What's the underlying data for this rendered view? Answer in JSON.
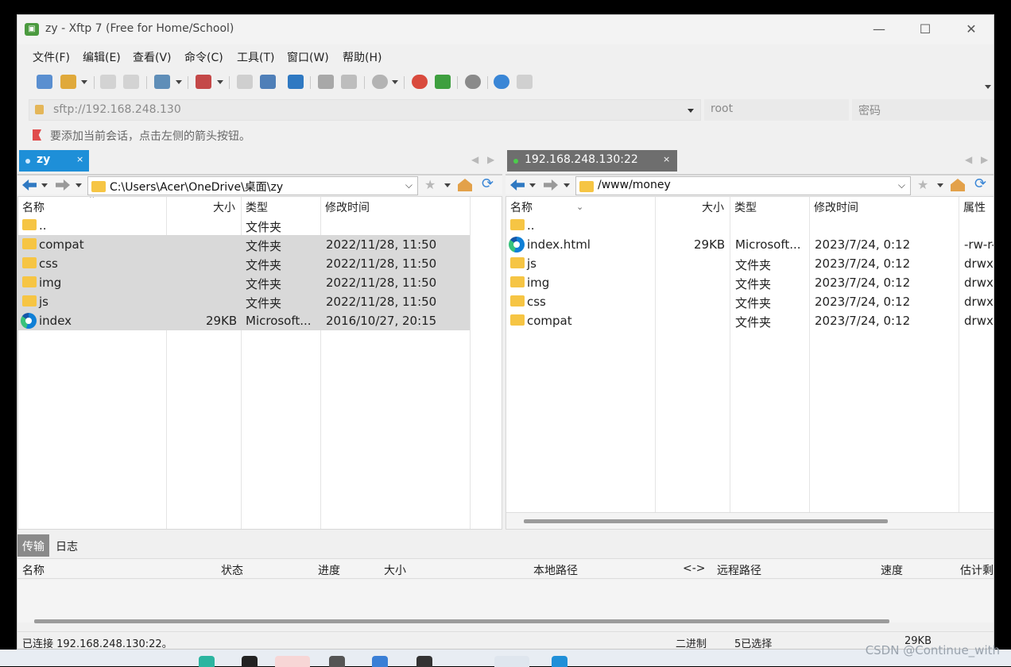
{
  "window": {
    "title": "zy - Xftp 7 (Free for Home/School)",
    "app_icon": "xftp-icon",
    "minimize": "—",
    "maximize": "☐",
    "close": "✕"
  },
  "menu": [
    "文件(F)",
    "编辑(E)",
    "查看(V)",
    "命令(C)",
    "工具(T)",
    "窗口(W)",
    "帮助(H)"
  ],
  "address": {
    "host": "sftp://192.168.248.130",
    "user_placeholder": "root",
    "password_placeholder": "密码"
  },
  "hint": "要添加当前会话，点击左侧的箭头按钮。",
  "left_pane": {
    "tab_label": "zy",
    "tab_close": "×",
    "path": "C:\\Users\\Acer\\OneDrive\\桌面\\zy",
    "columns": [
      "名称",
      "大小",
      "类型",
      "修改时间"
    ],
    "rows": [
      {
        "name": "..",
        "size": "",
        "type": "文件夹",
        "modified": "",
        "icon": "folder-icon",
        "selected": false
      },
      {
        "name": "compat",
        "size": "",
        "type": "文件夹",
        "modified": "2022/11/28, 11:50",
        "icon": "folder-icon",
        "selected": true
      },
      {
        "name": "css",
        "size": "",
        "type": "文件夹",
        "modified": "2022/11/28, 11:50",
        "icon": "folder-icon",
        "selected": true
      },
      {
        "name": "img",
        "size": "",
        "type": "文件夹",
        "modified": "2022/11/28, 11:50",
        "icon": "folder-icon",
        "selected": true
      },
      {
        "name": "js",
        "size": "",
        "type": "文件夹",
        "modified": "2022/11/28, 11:50",
        "icon": "folder-icon",
        "selected": true
      },
      {
        "name": "index",
        "size": "29KB",
        "type": "Microsoft...",
        "modified": "2016/10/27, 20:15",
        "icon": "edge-icon",
        "selected": true
      }
    ]
  },
  "right_pane": {
    "tab_label": "192.168.248.130:22",
    "tab_close": "×",
    "path": "/www/money",
    "columns": [
      "名称",
      "大小",
      "类型",
      "修改时间",
      "属性"
    ],
    "rows": [
      {
        "name": "..",
        "size": "",
        "type": "",
        "modified": "",
        "attr": "",
        "icon": "folder-icon"
      },
      {
        "name": "index.html",
        "size": "29KB",
        "type": "Microsoft...",
        "modified": "2023/7/24, 0:12",
        "attr": "-rw-r-",
        "icon": "edge-icon"
      },
      {
        "name": "js",
        "size": "",
        "type": "文件夹",
        "modified": "2023/7/24, 0:12",
        "attr": "drwx",
        "icon": "folder-icon"
      },
      {
        "name": "img",
        "size": "",
        "type": "文件夹",
        "modified": "2023/7/24, 0:12",
        "attr": "drwx",
        "icon": "folder-icon"
      },
      {
        "name": "css",
        "size": "",
        "type": "文件夹",
        "modified": "2023/7/24, 0:12",
        "attr": "drwx",
        "icon": "folder-icon"
      },
      {
        "name": "compat",
        "size": "",
        "type": "文件夹",
        "modified": "2023/7/24, 0:12",
        "attr": "drwx",
        "icon": "folder-icon"
      }
    ]
  },
  "transfer": {
    "tabs": [
      "传输",
      "日志"
    ],
    "columns": [
      "名称",
      "状态",
      "进度",
      "大小",
      "本地路径",
      "<->",
      "远程路径",
      "速度",
      "估计剩"
    ]
  },
  "status": {
    "connected": "已连接 192.168.248.130:22。",
    "mode": "二进制",
    "selected": "5已选择",
    "size": "29KB"
  },
  "watermark": "CSDN @Continue_with",
  "colors": {
    "accent": "#1e8fd8",
    "selection": "#d9d9d9",
    "folder": "#f6c544"
  }
}
